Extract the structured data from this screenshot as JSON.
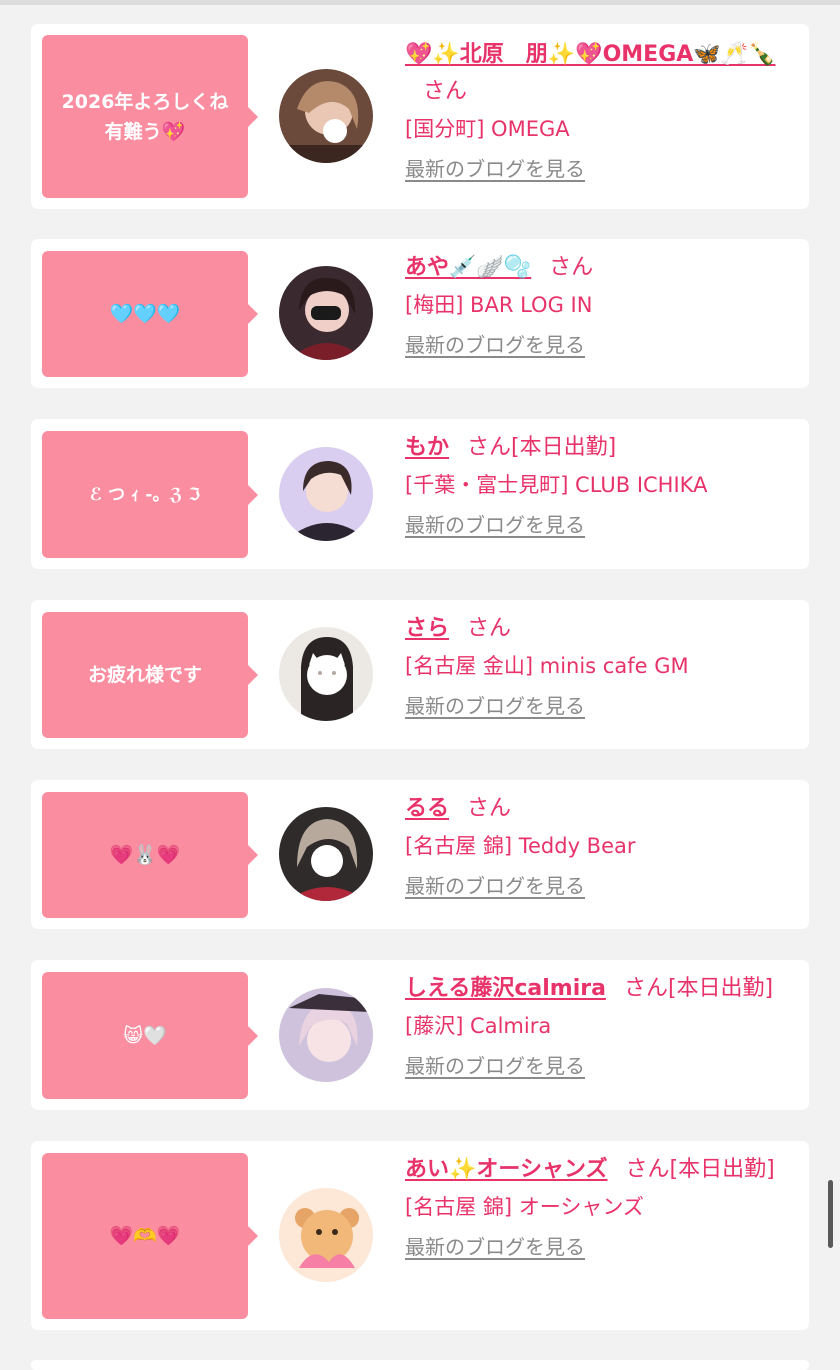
{
  "entries": [
    {
      "message": "2026年よろしくね\n有難う💖",
      "name": "💖✨北原　朋✨💖OMEGA🦋🥂🍾",
      "san": "さん",
      "status": "",
      "shop": "[国分町] OMEGA",
      "blog_link": "最新のブログを見る",
      "avatar_color": "#6b4a3c"
    },
    {
      "message": "🩵🩵🩵",
      "name": "あや💉🪽🫧",
      "san": "さん",
      "status": "",
      "shop": "[梅田] BAR LOG IN",
      "blog_link": "最新のブログを見る",
      "avatar_color": "#3a2a2f"
    },
    {
      "message": "ℰ つ ｨ -。ℨ ℑ",
      "name": "もか",
      "san": "さん",
      "status": "[本日出勤]",
      "shop": "[千葉・富士見町] CLUB ICHIKA",
      "blog_link": "最新のブログを見る",
      "avatar_color": "#c9b8e6"
    },
    {
      "message": "お疲れ様です",
      "name": "さら",
      "san": "さん",
      "status": "",
      "shop": "[名古屋 金山] minis cafe GM",
      "blog_link": "最新のブログを見る",
      "avatar_color": "#e9e6e2"
    },
    {
      "message": "💗🐰💗",
      "name": "るる",
      "san": "さん",
      "status": "",
      "shop": "[名古屋 錦] Teddy Bear",
      "blog_link": "最新のブログを見る",
      "avatar_color": "#2f2b2b"
    },
    {
      "message": "😸🤍",
      "name": "しえる藤沢calmira",
      "san": "さん",
      "status": "[本日出勤]",
      "shop": "[藤沢] Calmira",
      "blog_link": "最新のブログを見る",
      "avatar_color": "#b9a8c8"
    },
    {
      "message": "💗🫶💗",
      "name": "あい✨オーシャンズ",
      "san": "さん",
      "status": "[本日出勤]",
      "shop": "[名古屋 錦] オーシャンズ",
      "blog_link": "最新のブログを見る",
      "avatar_color": "#f3c08a"
    }
  ]
}
